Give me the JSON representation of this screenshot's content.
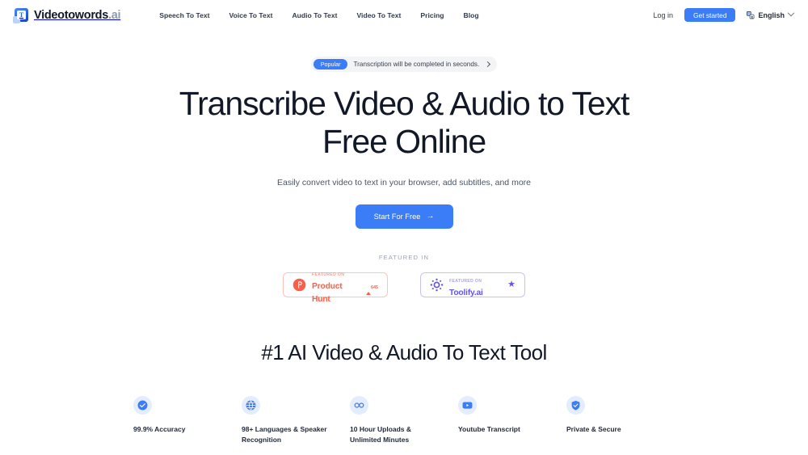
{
  "nav": {
    "brand": {
      "name_main": "Videotowords",
      "name_suffix": ".ai"
    },
    "links": [
      {
        "label": "Speech To Text"
      },
      {
        "label": "Voice To Text"
      },
      {
        "label": "Audio To Text"
      },
      {
        "label": "Video To Text"
      },
      {
        "label": "Pricing"
      },
      {
        "label": "Blog"
      }
    ],
    "login_label": "Log in",
    "get_started_label": "Get started",
    "language_label": "English"
  },
  "hero": {
    "pill_tag": "Popular",
    "pill_text": "Transcription will be completed in seconds.",
    "headline": "Transcribe Video & Audio to Text Free Online",
    "subhead": "Easily convert video to text in your browser, add subtitles, and more",
    "cta_label": "Start For Free",
    "cta_arrow": "→"
  },
  "featured": {
    "label": "FEATURED IN",
    "badges": [
      {
        "kicker": "FEATURED ON",
        "name": "Product Hunt",
        "count": "645",
        "accent": "#f8604a"
      },
      {
        "kicker": "FEATURED ON",
        "name": "Toolify.ai",
        "star": "★",
        "accent": "#6355e3"
      }
    ]
  },
  "section": {
    "title": "#1 AI Video & Audio To Text Tool",
    "features": [
      {
        "icon": "check-circle-icon",
        "label": "99.9% Accuracy"
      },
      {
        "icon": "globe-icon",
        "label": "98+ Languages & Speaker Recognition"
      },
      {
        "icon": "infinity-icon",
        "label": "10 Hour Uploads & Unlimited Minutes"
      },
      {
        "icon": "youtube-icon",
        "label": "Youtube Transcript"
      },
      {
        "icon": "shield-check-icon",
        "label": "Private & Secure"
      }
    ]
  },
  "colors": {
    "accent_blue": "#3b7df6",
    "icon_bg": "#e3edfd"
  }
}
